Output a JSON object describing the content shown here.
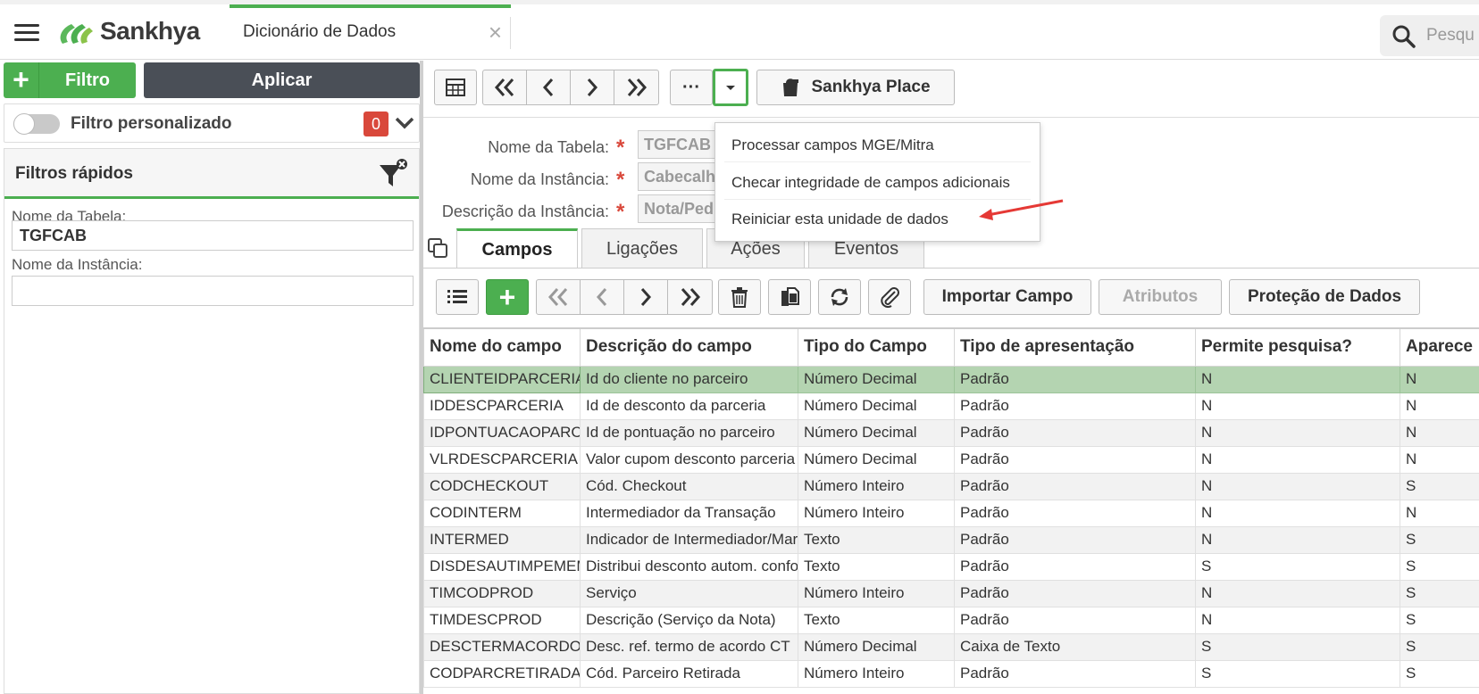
{
  "header": {
    "brand": "Sankhya",
    "app_tab_title": "Dicionário de Dados",
    "close_glyph": "×",
    "search_placeholder": "Pesqu"
  },
  "left_panel": {
    "add_glyph": "+",
    "filter_button": "Filtro",
    "apply_button": "Aplicar",
    "custom_filter_label": "Filtro personalizado",
    "custom_filter_count": "0",
    "quick_filters_title": "Filtros rápidos",
    "fields": [
      {
        "label": "Nome da Tabela:",
        "value": "TGFCAB"
      },
      {
        "label": "Nome da Instância:",
        "value": ""
      }
    ]
  },
  "toolbar": {
    "more_glyph": "···",
    "place_label": "Sankhya Place"
  },
  "form": {
    "required_mark": "*",
    "fields": [
      {
        "label": "Nome da Tabela:",
        "value": "TGFCAB"
      },
      {
        "label": "Nome da Instância:",
        "value": "Cabecalh"
      },
      {
        "label": "Descrição da Instância:",
        "value": "Nota/Ped"
      }
    ]
  },
  "dropdown_menu": {
    "items": [
      "Processar campos MGE/Mitra",
      "Checar integridade de campos adicionais",
      "Reiniciar esta unidade de dados"
    ]
  },
  "tabs": [
    "Campos",
    "Ligações",
    "Ações",
    "Eventos"
  ],
  "grid_toolbar": {
    "add_glyph": "+",
    "import_button": "Importar Campo",
    "attributes_button": "Atributos",
    "data_protection_button": "Proteção de Dados"
  },
  "table": {
    "columns": [
      "Nome do campo",
      "Descrição do campo",
      "Tipo do Campo",
      "Tipo de apresentação",
      "Permite pesquisa?",
      "Aparece"
    ],
    "rows": [
      [
        "CLIENTEIDPARCERIA",
        "Id do cliente no parceiro",
        "Número Decimal",
        "Padrão",
        "N",
        "N"
      ],
      [
        "IDDESCPARCERIA",
        "Id de desconto da parceria",
        "Número Decimal",
        "Padrão",
        "N",
        "N"
      ],
      [
        "IDPONTUACAOPARC",
        "Id de pontuação no parceiro",
        "Número Decimal",
        "Padrão",
        "N",
        "N"
      ],
      [
        "VLRDESCPARCERIA",
        "Valor cupom desconto parceria",
        "Número Decimal",
        "Padrão",
        "N",
        "N"
      ],
      [
        "CODCHECKOUT",
        "Cód. Checkout",
        "Número Inteiro",
        "Padrão",
        "N",
        "S"
      ],
      [
        "CODINTERM",
        "Intermediador da Transação",
        "Número Inteiro",
        "Padrão",
        "N",
        "N"
      ],
      [
        "INTERMED",
        "Indicador de Intermediador/Marketplace",
        "Texto",
        "Padrão",
        "N",
        "S"
      ],
      [
        "DISDESAUTIMPEMEMP",
        "Distribui desconto autom. conforme",
        "Texto",
        "Padrão",
        "S",
        "S"
      ],
      [
        "TIMCODPROD",
        "Serviço",
        "Número Inteiro",
        "Padrão",
        "N",
        "S"
      ],
      [
        "TIMDESCPROD",
        "Descrição (Serviço da Nota)",
        "Texto",
        "Padrão",
        "N",
        "S"
      ],
      [
        "DESCTERMACORDO",
        "Desc. ref. termo de acordo CT",
        "Número Decimal",
        "Caixa de Texto",
        "S",
        "S"
      ],
      [
        "CODPARCRETIRADA",
        "Cód. Parceiro Retirada",
        "Número Inteiro",
        "Padrão",
        "S",
        "S"
      ]
    ]
  },
  "colors": {
    "accent_green": "#4caf50",
    "selected_row": "#b4d4b1",
    "badge_red": "#d9483b",
    "dark_button": "#4a4f57",
    "annotation_arrow": "#e53935"
  }
}
